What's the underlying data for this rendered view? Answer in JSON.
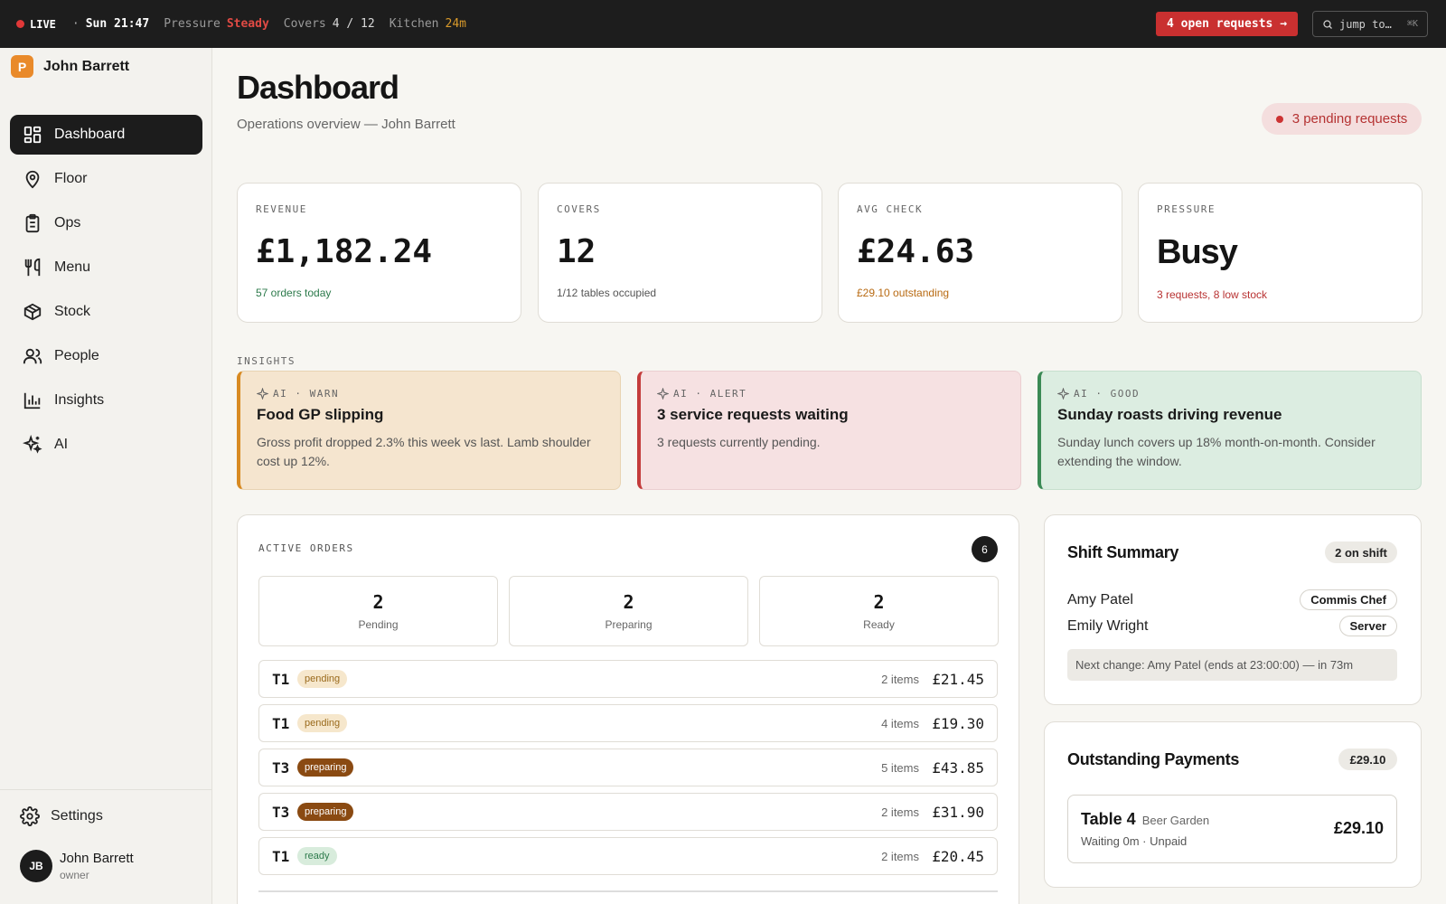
{
  "topbar": {
    "live": "LIVE",
    "separator": "·",
    "time": "Sun 21:47",
    "pressure_label": "Pressure",
    "pressure_value": "Steady",
    "covers_label": "Covers",
    "covers_value": "4 / 12",
    "kitchen_label": "Kitchen",
    "kitchen_value": "24m",
    "requests_button": "4 open requests →",
    "jump_placeholder": "jump to…",
    "jump_shortcut": "⌘K"
  },
  "sidebar": {
    "brand_logo": "P",
    "brand_name": "John Barrett",
    "items": [
      {
        "label": "Dashboard",
        "icon": "grid-icon",
        "active": true
      },
      {
        "label": "Floor",
        "icon": "map-pin-icon"
      },
      {
        "label": "Ops",
        "icon": "clipboard-icon"
      },
      {
        "label": "Menu",
        "icon": "utensils-icon"
      },
      {
        "label": "Stock",
        "icon": "box-icon"
      },
      {
        "label": "People",
        "icon": "users-icon"
      },
      {
        "label": "Insights",
        "icon": "bar-chart-icon"
      },
      {
        "label": "AI",
        "icon": "sparkles-icon"
      }
    ],
    "settings_label": "Settings",
    "user": {
      "initials": "JB",
      "name": "John Barrett",
      "role": "owner"
    }
  },
  "header": {
    "title": "Dashboard",
    "subtitle": "Operations overview — John Barrett",
    "pending_pill": "3 pending requests"
  },
  "kpis": [
    {
      "label": "REVENUE",
      "value": "£1,182.24",
      "sub": "57 orders today",
      "sub_color": "#2c7a4b"
    },
    {
      "label": "COVERS",
      "value": "12",
      "sub": "1/12 tables occupied",
      "sub_color": "#555555"
    },
    {
      "label": "AVG CHECK",
      "value": "£24.63",
      "sub": "£29.10 outstanding",
      "sub_color": "#b86a12"
    },
    {
      "label": "PRESSURE",
      "value": "Busy",
      "sub": "3 requests, 8 low stock",
      "sub_color": "#b83232"
    }
  ],
  "insights": {
    "label": "INSIGHTS",
    "cards": [
      {
        "tag": "AI · WARN",
        "title": "Food GP slipping",
        "body": "Gross profit dropped 2.3% this week vs last. Lamb shoulder cost up 12%."
      },
      {
        "tag": "AI · ALERT",
        "title": "3 service requests waiting",
        "body": "3 requests currently pending."
      },
      {
        "tag": "AI · GOOD",
        "title": "Sunday roasts driving revenue",
        "body": "Sunday lunch covers up 18% month-on-month. Consider extending the window."
      }
    ]
  },
  "orders": {
    "label": "ACTIVE ORDERS",
    "count": "6",
    "stats": [
      {
        "num": "2",
        "label": "Pending"
      },
      {
        "num": "2",
        "label": "Preparing"
      },
      {
        "num": "2",
        "label": "Ready"
      }
    ],
    "rows": [
      {
        "table": "T1",
        "status": "pending",
        "items": "2 items",
        "total": "£21.45"
      },
      {
        "table": "T1",
        "status": "pending",
        "items": "4 items",
        "total": "£19.30"
      },
      {
        "table": "T3",
        "status": "preparing",
        "items": "5 items",
        "total": "£43.85"
      },
      {
        "table": "T3",
        "status": "preparing",
        "items": "2 items",
        "total": "£31.90"
      },
      {
        "table": "T1",
        "status": "ready",
        "items": "2 items",
        "total": "£20.45"
      }
    ]
  },
  "shift": {
    "title": "Shift Summary",
    "badge": "2 on shift",
    "staff": [
      {
        "name": "Amy Patel",
        "role": "Commis Chef"
      },
      {
        "name": "Emily Wright",
        "role": "Server"
      }
    ],
    "next_change": "Next change: Amy Patel (ends at 23:00:00) — in 73m"
  },
  "payments": {
    "title": "Outstanding Payments",
    "badge": "£29.10",
    "items": [
      {
        "table": "Table 4",
        "area": "Beer Garden",
        "status": "Waiting 0m · Unpaid",
        "amount": "£29.10"
      }
    ]
  }
}
